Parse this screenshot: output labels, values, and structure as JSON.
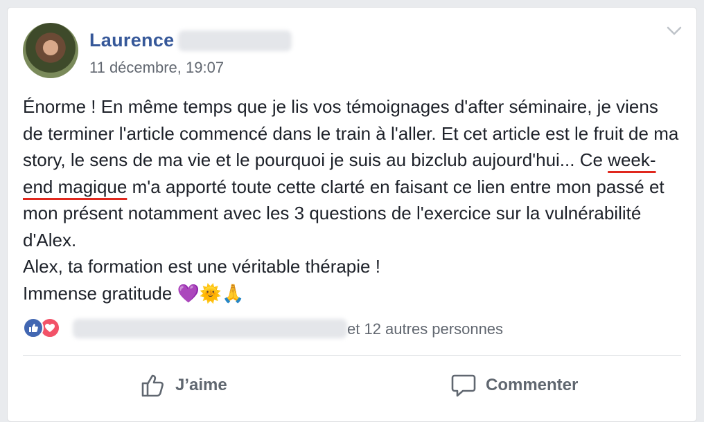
{
  "post": {
    "author_name": "Laurence",
    "timestamp": "11 décembre, 19:07",
    "text_part1": "Énorme ! En même temps que je lis vos témoignages d'after séminaire, je viens de terminer l'article commencé dans le train à l'aller. Et cet article est le fruit de ma story, le sens de ma vie et le pourquoi je suis au bizclub aujourd'hui... Ce ",
    "text_highlight": "week-end magique",
    "text_part2": " m'a apporté toute cette clarté en faisant ce lien entre mon passé et mon présent notamment avec les 3 questions de l'exercice sur la vulnérabilité d'Alex.",
    "text_line2": "Alex, ta formation est une véritable thérapie !",
    "text_line3": "Immense gratitude 💜🌞🙏"
  },
  "reactions": {
    "others_text": "et 12 autres personnes",
    "icons": [
      "like-icon",
      "love-icon"
    ]
  },
  "actions": {
    "like_label": "J’aime",
    "comment_label": "Commenter"
  },
  "colors": {
    "author": "#365899",
    "like_blue": "#4267b2",
    "love_red": "#f25268",
    "underline": "#e0281e"
  }
}
